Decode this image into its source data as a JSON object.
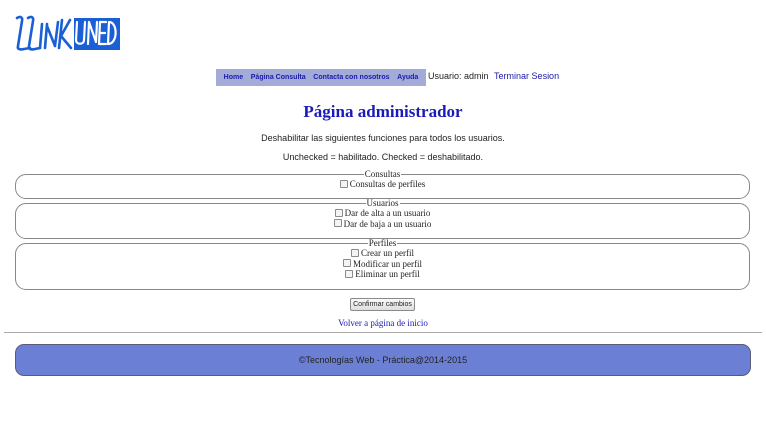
{
  "brand": {
    "logo_icon": "linkunedin-logo-icon",
    "logo_color": "#1a5fd6"
  },
  "nav": {
    "items": [
      "Home",
      "Página Consulta",
      "Contacta con nosotros",
      "Ayuda"
    ],
    "background": "#a3acd9",
    "link_color": "#1a1aa6"
  },
  "user": {
    "text": "Usuario: admin",
    "logout_label": "Terminar Sesion"
  },
  "page": {
    "title": "Página administrador",
    "line1": "Deshabilitar las siguientes funciones para todos los usuarios.",
    "line2": "Unchecked = habilitado. Checked = deshabilitado."
  },
  "groups": [
    {
      "legend": "Consultas",
      "options": [
        {
          "label": "Consultas de perfiles",
          "checked": false
        }
      ]
    },
    {
      "legend": "Usuarios",
      "options": [
        {
          "label": "Dar de alta a un usuario",
          "checked": false
        },
        {
          "label": "Dar de baja a un usuario",
          "checked": false
        }
      ]
    },
    {
      "legend": "Perfiles",
      "options": [
        {
          "label": "Crear un perfil",
          "checked": false
        },
        {
          "label": "Modificar un perfil",
          "checked": false
        },
        {
          "label": "Eliminar un perfil",
          "checked": false
        }
      ]
    }
  ],
  "actions": {
    "confirm_label": "Confirmar cambios",
    "back_label": "Volver a página de inicio"
  },
  "footer": {
    "text": "©Tecnologías Web - Práctica@2014-2015",
    "background": "#6b80d4"
  }
}
